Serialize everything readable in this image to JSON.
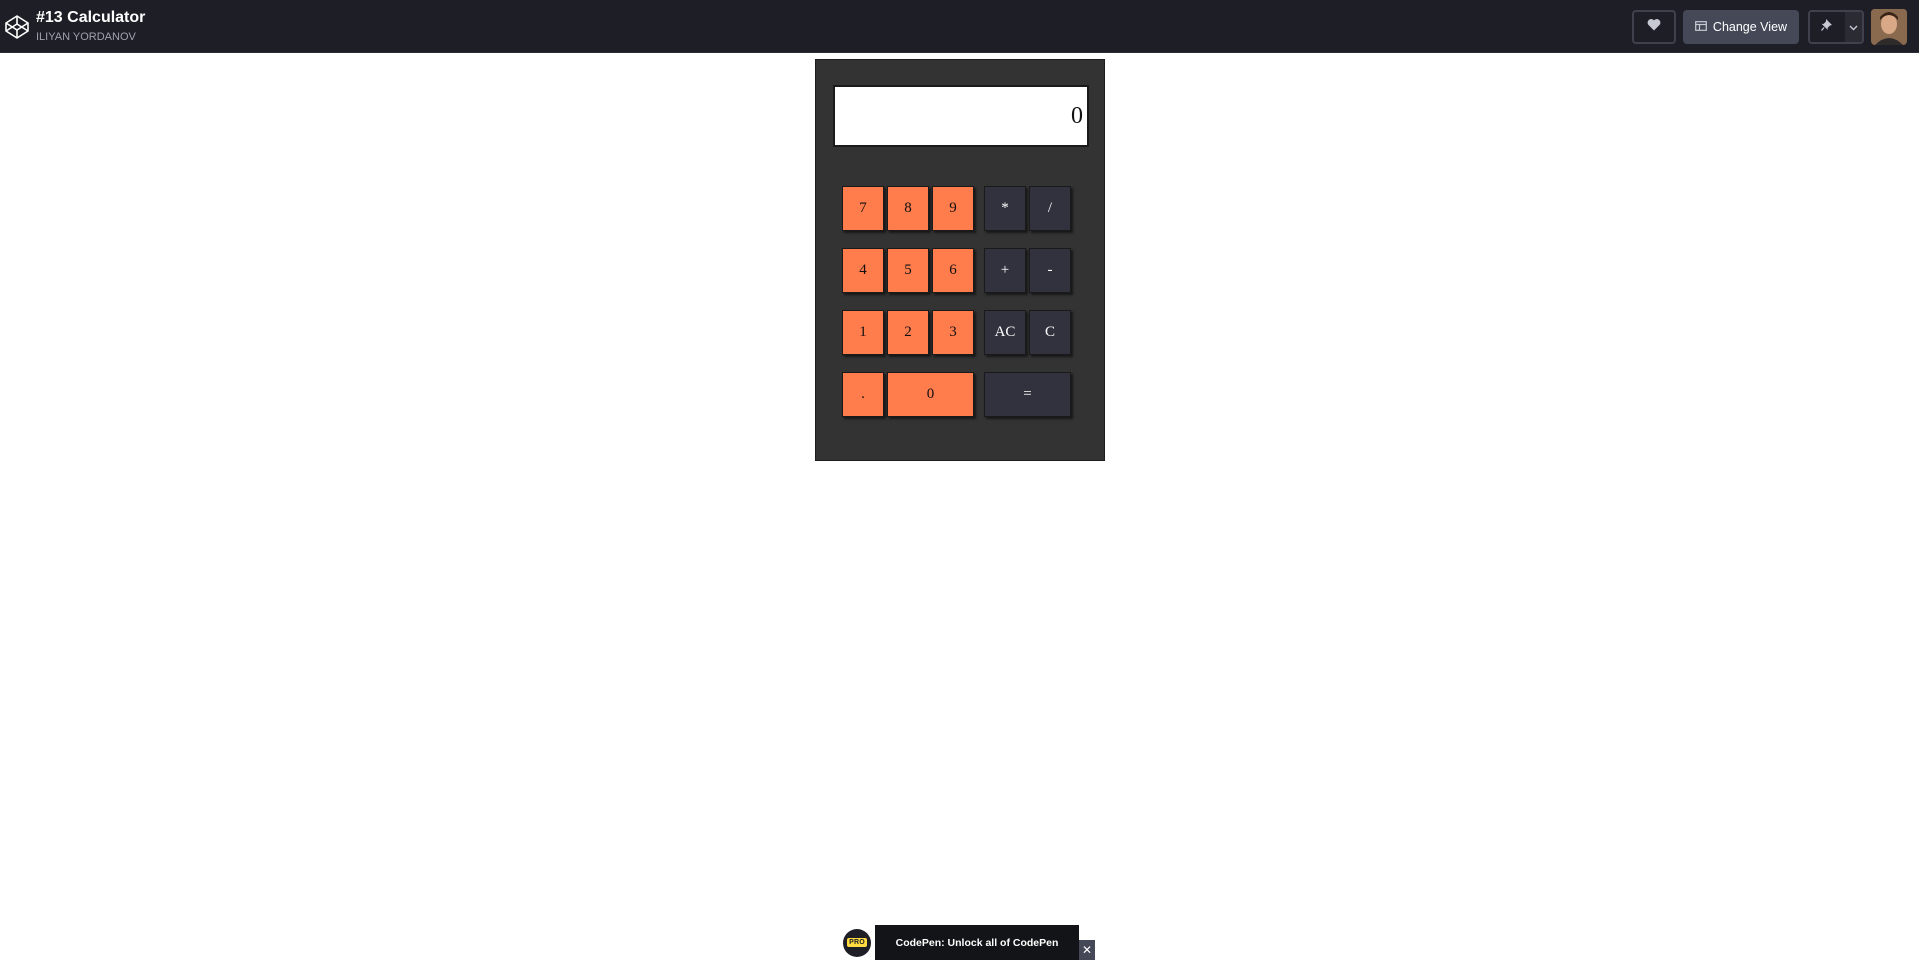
{
  "header": {
    "pen_title": "#13 Calculator",
    "author": "ILIYAN YORDANOV",
    "like_icon": "heart-icon",
    "change_view_label": "Change View",
    "change_view_icon": "layout-icon",
    "pin_icon": "pin-icon",
    "dropdown_icon": "chevron-down-icon",
    "logo_icon": "codepen-logo-icon"
  },
  "calculator": {
    "display_value": "0",
    "keys": [
      {
        "label": "7",
        "kind": "number"
      },
      {
        "label": "8",
        "kind": "number"
      },
      {
        "label": "9",
        "kind": "number"
      },
      {
        "label": "*",
        "kind": "operator"
      },
      {
        "label": "/",
        "kind": "operator"
      },
      {
        "label": "4",
        "kind": "number"
      },
      {
        "label": "5",
        "kind": "number"
      },
      {
        "label": "6",
        "kind": "number"
      },
      {
        "label": "+",
        "kind": "operator"
      },
      {
        "label": "-",
        "kind": "operator"
      },
      {
        "label": "1",
        "kind": "number"
      },
      {
        "label": "2",
        "kind": "number"
      },
      {
        "label": "3",
        "kind": "number"
      },
      {
        "label": "AC",
        "kind": "operator"
      },
      {
        "label": "C",
        "kind": "operator"
      },
      {
        "label": ".",
        "kind": "number"
      },
      {
        "label": "0",
        "kind": "number"
      },
      {
        "label": "=",
        "kind": "operator"
      }
    ],
    "colors": {
      "body": "#333333",
      "number_key": "#ff7c4c",
      "operator_key": "#32323f",
      "display_bg": "#ffffff"
    }
  },
  "promo": {
    "badge": "PRO",
    "text": "CodePen: Unlock all of CodePen",
    "close_label": "✕"
  },
  "colors": {
    "topbar": "#1e1f26",
    "button_secondary": "#444857"
  }
}
